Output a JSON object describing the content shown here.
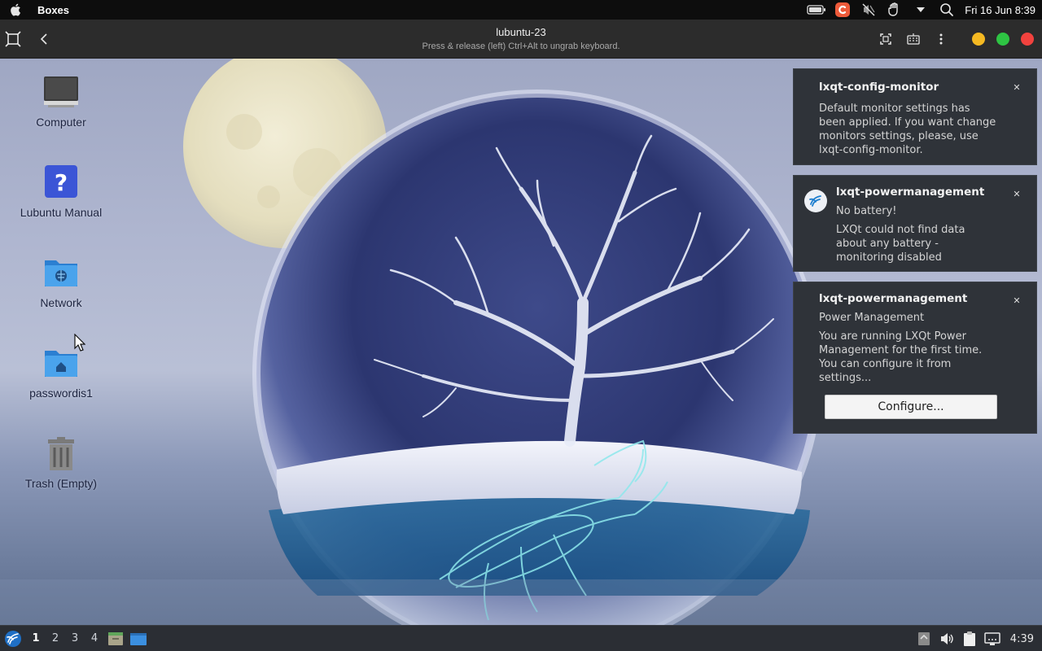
{
  "topbar": {
    "app_name": "Boxes",
    "clock": "Fri 16 Jun  8:39",
    "icons": [
      "apple-icon",
      "battery-icon",
      "app-indicator-icon",
      "mic-muted-icon",
      "hand-icon",
      "dropdown-icon",
      "search-icon"
    ]
  },
  "header": {
    "title": "lubuntu-23",
    "subtitle": "Press & release (left) Ctrl+Alt to ungrab keyboard.",
    "window_colors": {
      "minimize": "#f5b922",
      "maximize": "#2ec443",
      "close": "#f2423e"
    }
  },
  "desktop": {
    "icons": [
      {
        "label": "Computer",
        "icon": "computer-icon"
      },
      {
        "label": "Lubuntu Manual",
        "icon": "help-icon"
      },
      {
        "label": "Network",
        "icon": "network-folder-icon"
      },
      {
        "label": "passwordis1",
        "icon": "home-folder-icon"
      },
      {
        "label": "Trash (Empty)",
        "icon": "trash-icon"
      }
    ]
  },
  "notifications": [
    {
      "title": "lxqt-config-monitor",
      "body": [
        "Default monitor settings has",
        "been applied. If you want change",
        "monitors settings, please, use",
        "lxqt-config-monitor."
      ]
    },
    {
      "title": "lxqt-powermanagement",
      "body": [
        "No battery!",
        "LXQt could not find data",
        "about any battery -",
        "monitoring disabled"
      ]
    },
    {
      "title": "lxqt-powermanagement",
      "body": [
        "Power Management",
        "You are running LXQt Power",
        "Management for the first time.",
        "You can configure it from",
        "settings..."
      ],
      "button": "Configure..."
    }
  ],
  "panel": {
    "workspaces": [
      "1",
      "2",
      "3",
      "4"
    ],
    "active_workspace": "1",
    "clock": "4:39"
  }
}
